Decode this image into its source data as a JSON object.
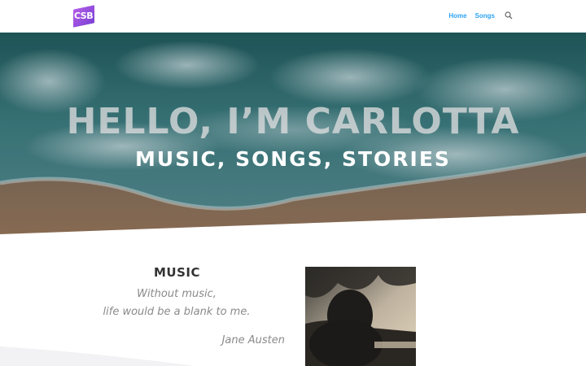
{
  "header": {
    "logo_text": "CSB",
    "nav": [
      {
        "label": "Home"
      },
      {
        "label": "Songs"
      }
    ],
    "search_icon": "search-icon"
  },
  "hero": {
    "title": "HELLO, I’M CARLOTTA",
    "subtitle": "MUSIC, SONGS, STORIES"
  },
  "music": {
    "title": "MUSIC",
    "quote_line1": "Without music,",
    "quote_line2": "life would be a blank to me.",
    "author": "Jane Austen"
  },
  "colors": {
    "accent": "#2ea3f2",
    "logo_purple": "#9b4fe0",
    "heading": "#333333",
    "quote": "#8a8a8a"
  }
}
